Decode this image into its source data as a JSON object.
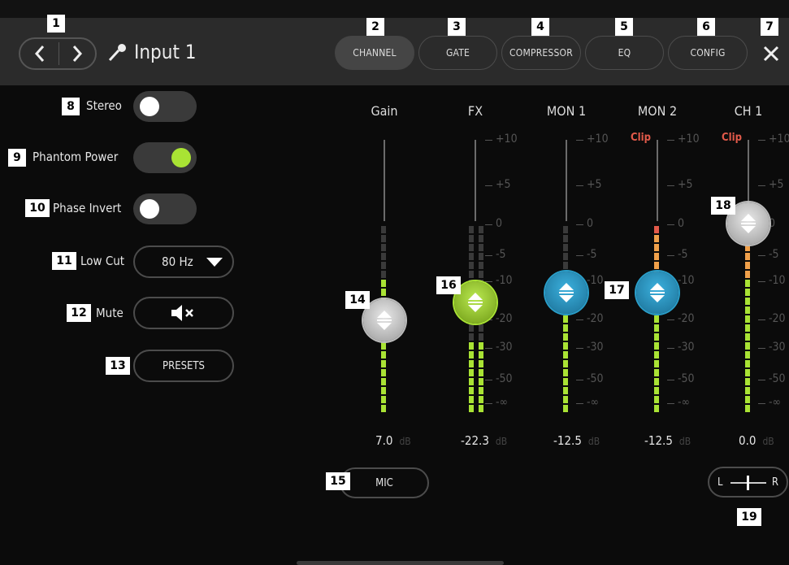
{
  "header": {
    "input_name": "Input 1",
    "tabs": [
      {
        "label": "CHANNEL",
        "active": true
      },
      {
        "label": "GATE",
        "active": false
      },
      {
        "label": "COMPRESSOR",
        "active": false
      },
      {
        "label": "EQ",
        "active": false
      },
      {
        "label": "CONFIG",
        "active": false
      }
    ]
  },
  "badges": [
    "1",
    "2",
    "3",
    "4",
    "5",
    "6",
    "7",
    "8",
    "9",
    "10",
    "11",
    "12",
    "13",
    "14",
    "15",
    "16",
    "17",
    "18",
    "19"
  ],
  "settings": {
    "stereo": {
      "label": "Stereo",
      "on": false
    },
    "phantom": {
      "label": "Phantom Power",
      "on": true
    },
    "phase": {
      "label": "Phase Invert",
      "on": false
    },
    "low_cut": {
      "label": "Low Cut",
      "value": "80 Hz"
    },
    "mute": {
      "label": "Mute"
    },
    "presets": {
      "label": "PRESETS"
    }
  },
  "scale": [
    "+10",
    "+5",
    "0",
    "-5",
    "-10",
    "-20",
    "-30",
    "-50",
    "-∞"
  ],
  "channels": [
    {
      "name": "Gain",
      "value": "7.0",
      "unit": "dB",
      "clip": ""
    },
    {
      "name": "FX",
      "value": "-22.3",
      "unit": "dB",
      "clip": ""
    },
    {
      "name": "MON 1",
      "value": "-12.5",
      "unit": "dB",
      "clip": ""
    },
    {
      "name": "MON 2",
      "value": "-12.5",
      "unit": "dB",
      "clip": "Clip"
    },
    {
      "name": "CH 1",
      "value": "0.0",
      "unit": "dB",
      "clip": "Clip"
    }
  ],
  "mic_button": "MIC",
  "pan": {
    "left": "L",
    "right": "R"
  },
  "colors": {
    "accent_green": "#a9e334",
    "mon_blue": "#2a9ec9",
    "clip_red": "#e25a4a",
    "meter_orange": "#f0a04a"
  },
  "icons": [
    "chevron-left-icon",
    "chevron-right-icon",
    "microphone-icon",
    "close-icon",
    "dropdown-arrow-icon",
    "speaker-mute-icon"
  ]
}
